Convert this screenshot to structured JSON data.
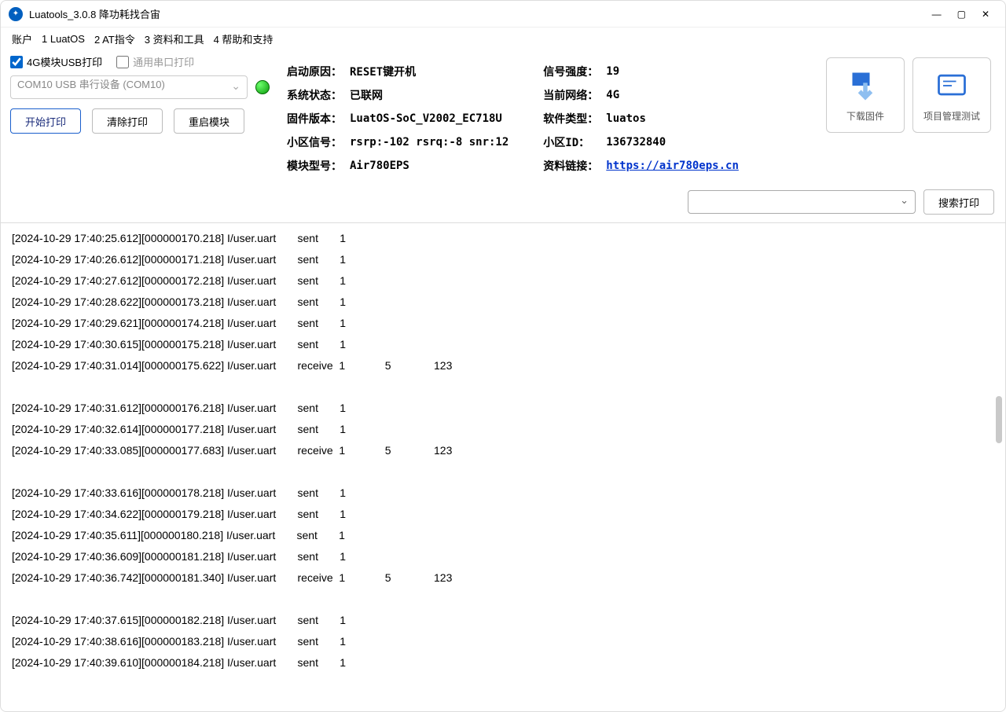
{
  "window": {
    "title": "Luatools_3.0.8 降功耗找合宙"
  },
  "menu": {
    "items": [
      "账户",
      "1 LuatOS",
      "2 AT指令",
      "3 资料和工具",
      "4 帮助和支持"
    ]
  },
  "toolbar": {
    "chk_usb_label": "4G模块USB打印",
    "chk_usb_checked": true,
    "chk_serial_label": "通用串口打印",
    "chk_serial_checked": false,
    "port_selected": "COM10 USB 串行设备 (COM10)",
    "btn_start": "开始打印",
    "btn_clear": "清除打印",
    "btn_restart": "重启模块"
  },
  "info": {
    "left": [
      {
        "label": "启动原因：",
        "value": "RESET键开机"
      },
      {
        "label": "系统状态：",
        "value": "已联网"
      },
      {
        "label": "固件版本：",
        "value": "LuatOS-SoC_V2002_EC718U"
      },
      {
        "label": "小区信号：",
        "value": "rsrp:-102 rsrq:-8 snr:12"
      },
      {
        "label": "模块型号：",
        "value": "Air780EPS"
      }
    ],
    "right": [
      {
        "label": "信号强度：",
        "value": "19"
      },
      {
        "label": "当前网络：",
        "value": "4G"
      },
      {
        "label": "软件类型：",
        "value": "luatos"
      },
      {
        "label": "小区ID：",
        "value": "136732840"
      },
      {
        "label": "资料链接：",
        "value": "https://air780eps.cn",
        "link": true
      }
    ]
  },
  "bigbtn": {
    "download": "下载固件",
    "project": "项目管理测试"
  },
  "search": {
    "btn": "搜索打印"
  },
  "log": {
    "lines": [
      "[2024-10-29 17:40:25.612][000000170.218] I/user.uart       sent       1",
      "[2024-10-29 17:40:26.612][000000171.218] I/user.uart       sent       1",
      "[2024-10-29 17:40:27.612][000000172.218] I/user.uart       sent       1",
      "[2024-10-29 17:40:28.622][000000173.218] I/user.uart       sent       1",
      "[2024-10-29 17:40:29.621][000000174.218] I/user.uart       sent       1",
      "[2024-10-29 17:40:30.615][000000175.218] I/user.uart       sent       1",
      "[2024-10-29 17:40:31.014][000000175.622] I/user.uart       receive  1             5              123",
      "",
      "[2024-10-29 17:40:31.612][000000176.218] I/user.uart       sent       1",
      "[2024-10-29 17:40:32.614][000000177.218] I/user.uart       sent       1",
      "[2024-10-29 17:40:33.085][000000177.683] I/user.uart       receive  1             5              123",
      "",
      "[2024-10-29 17:40:33.616][000000178.218] I/user.uart       sent       1",
      "[2024-10-29 17:40:34.622][000000179.218] I/user.uart       sent       1",
      "[2024-10-29 17:40:35.611][000000180.218] I/user.uart       sent       1",
      "[2024-10-29 17:40:36.609][000000181.218] I/user.uart       sent       1",
      "[2024-10-29 17:40:36.742][000000181.340] I/user.uart       receive  1             5              123",
      "",
      "[2024-10-29 17:40:37.615][000000182.218] I/user.uart       sent       1",
      "[2024-10-29 17:40:38.616][000000183.218] I/user.uart       sent       1",
      "[2024-10-29 17:40:39.610][000000184.218] I/user.uart       sent       1"
    ]
  }
}
